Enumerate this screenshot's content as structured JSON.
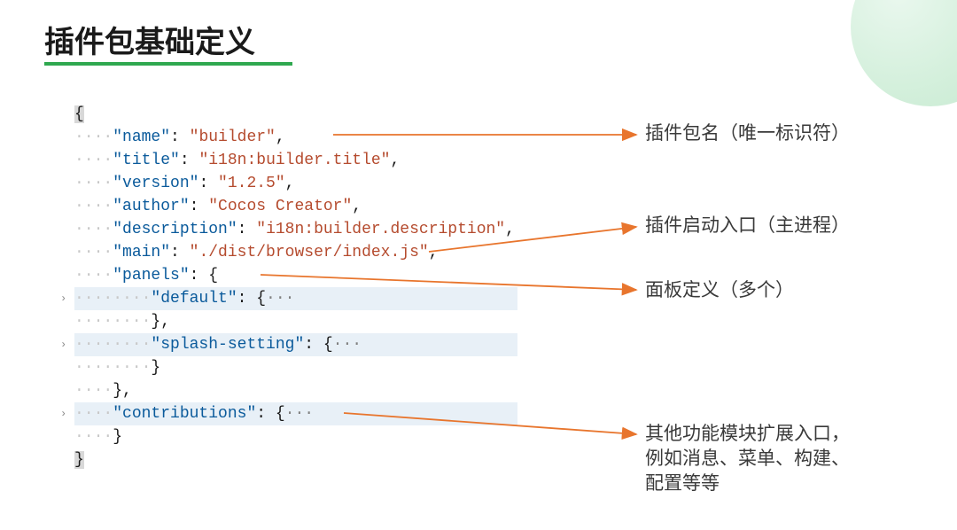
{
  "slide": {
    "title": "插件包基础定义"
  },
  "labels": {
    "name": "插件包名（唯一标识符）",
    "main": "插件启动入口（主进程）",
    "panels": "面板定义（多个）",
    "contributions": "其他功能模块扩展入口，\n例如消息、菜单、构建、\n配置等等"
  },
  "code": {
    "lines": [
      {
        "type": "plain",
        "dots": "",
        "text_open": "{",
        "hl": true
      },
      {
        "type": "kv",
        "dots": "····",
        "key": "\"name\"",
        "sep": ": ",
        "val": "\"builder\"",
        "tail": ","
      },
      {
        "type": "kv",
        "dots": "····",
        "key": "\"title\"",
        "sep": ": ",
        "val": "\"i18n:builder.title\"",
        "tail": ","
      },
      {
        "type": "kv",
        "dots": "····",
        "key": "\"version\"",
        "sep": ": ",
        "val": "\"1.2.5\"",
        "tail": ","
      },
      {
        "type": "kv",
        "dots": "····",
        "key": "\"author\"",
        "sep": ": ",
        "val": "\"Cocos Creator\"",
        "tail": ","
      },
      {
        "type": "kv",
        "dots": "····",
        "key": "\"description\"",
        "sep": ": ",
        "val": "\"i18n:builder.description\"",
        "tail": ","
      },
      {
        "type": "kv",
        "dots": "····",
        "key": "\"main\"",
        "sep": ": ",
        "val": "\"./dist/browser/index.js\"",
        "tail": ","
      },
      {
        "type": "open",
        "dots": "····",
        "key": "\"panels\"",
        "sep": ": {",
        "tail": ""
      },
      {
        "type": "fold",
        "dots": "········",
        "key": "\"default\"",
        "sep": ": {",
        "ell": "···"
      },
      {
        "type": "closeinner",
        "dots": "········",
        "text": "},"
      },
      {
        "type": "fold",
        "dots": "········",
        "key": "\"splash-setting\"",
        "sep": ": {",
        "ell": "···"
      },
      {
        "type": "closeinner",
        "dots": "········",
        "text": "}"
      },
      {
        "type": "close",
        "dots": "····",
        "text": "},"
      },
      {
        "type": "fold",
        "dots": "····",
        "key": "\"contributions\"",
        "sep": ": {",
        "ell": "···"
      },
      {
        "type": "close",
        "dots": "····",
        "text": "}"
      },
      {
        "type": "plain",
        "dots": "",
        "text_open": "}",
        "hl": true
      }
    ]
  }
}
